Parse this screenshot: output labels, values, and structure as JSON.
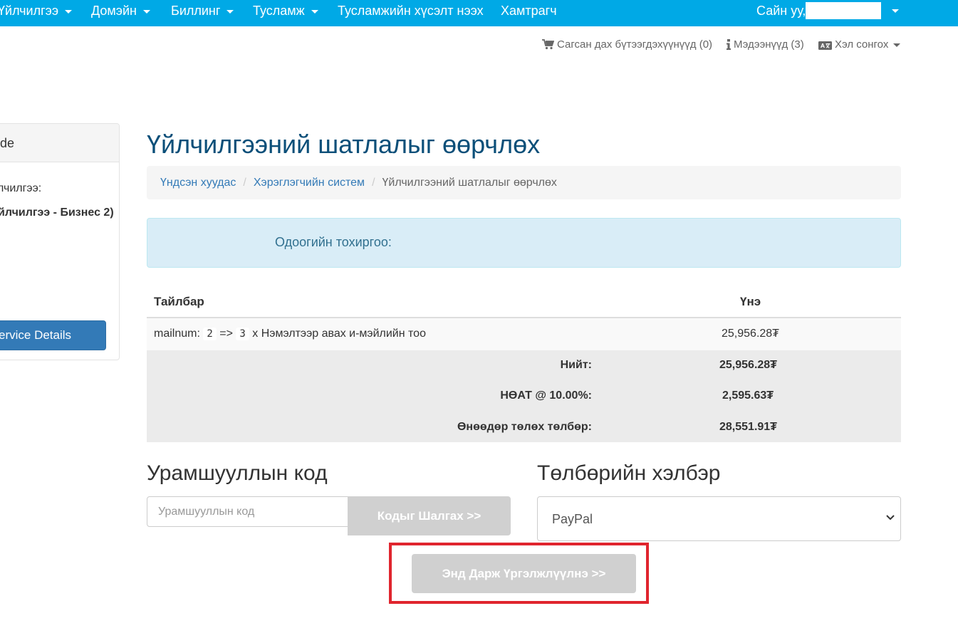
{
  "nav": {
    "items": [
      {
        "label": "Үйлчилгээ",
        "dropdown": true
      },
      {
        "label": "Домэйн",
        "dropdown": true
      },
      {
        "label": "Биллинг",
        "dropdown": true
      },
      {
        "label": "Тусламж",
        "dropdown": true
      },
      {
        "label": "Тусламжийн хүсэлт нээх",
        "dropdown": false
      },
      {
        "label": "Хамтрагч",
        "dropdown": false
      }
    ],
    "greeting": "Сайн уу,",
    "username": ""
  },
  "secondary": {
    "cart": "Сагсан дах бүтээгдэхүүнүүд (0)",
    "notifications": "Мэдээнүүд (3)",
    "language": "Хэл сонгох"
  },
  "sidebar": {
    "title": "de",
    "service_label": "лчилгээ:",
    "service_value": "йлчилгээ - Бизнес 2)",
    "details_button": "ervice Details"
  },
  "main": {
    "title": "Үйлчилгээний шатлалыг өөрчлөх",
    "breadcrumb": [
      "Үндсэн хуудас",
      "Хэрэглэгчийн систем",
      "Үйлчилгээний шатлалыг өөрчлөх"
    ],
    "current_config_label": "Одоогийн тохиргоо:",
    "table": {
      "col_desc": "Тайлбар",
      "col_price": "Үнэ",
      "row": {
        "prefix": "mailnum:",
        "from": "2",
        "arrow": "=>",
        "to": "3",
        "suffix": "x Нэмэлтээр авах и-мэйлийн тоо",
        "price": "25,956.28₮"
      }
    },
    "totals": [
      {
        "label": "Нийт:",
        "value": "25,956.28₮"
      },
      {
        "label": "НӨАТ @ 10.00%:",
        "value": "2,595.63₮"
      },
      {
        "label": "Өнөөдөр төлөх төлбөр:",
        "value": "28,551.91₮"
      }
    ],
    "promo": {
      "title": "Урамшууллын код",
      "placeholder": "Урамшууллын код",
      "button": "Кодыг Шалгах >>"
    },
    "payment": {
      "title": "Төлбөрийн хэлбэр",
      "selected": "PayPal"
    },
    "continue_button": "Энд Дарж Үргэлжлүүлнэ >>"
  },
  "colors": {
    "nav_bg": "#00a9e6",
    "title": "#0b4f79",
    "link": "#337ab7",
    "alert_bg": "#d9edf7",
    "highlight": "#e0252e"
  }
}
